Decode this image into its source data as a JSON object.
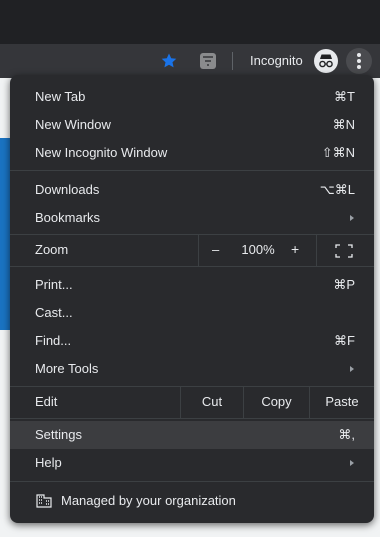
{
  "toolbar": {
    "incognito_label": "Incognito",
    "star_icon": "star-icon",
    "extension_icon": "extension-filter-icon",
    "profile_icon": "incognito-spy-icon",
    "menu_icon": "kebab-menu-icon",
    "accent_color": "#1a73e8"
  },
  "menu": {
    "new_tab": {
      "label": "New Tab",
      "shortcut": "⌘T"
    },
    "new_window": {
      "label": "New Window",
      "shortcut": "⌘N"
    },
    "new_incognito": {
      "label": "New Incognito Window",
      "shortcut": "⇧⌘N"
    },
    "downloads": {
      "label": "Downloads",
      "shortcut": "⌥⌘L"
    },
    "bookmarks": {
      "label": "Bookmarks"
    },
    "zoom": {
      "label": "Zoom",
      "minus": "–",
      "value": "100%",
      "plus": "+"
    },
    "print": {
      "label": "Print...",
      "shortcut": "⌘P"
    },
    "cast": {
      "label": "Cast..."
    },
    "find": {
      "label": "Find...",
      "shortcut": "⌘F"
    },
    "more_tools": {
      "label": "More Tools"
    },
    "edit": {
      "label": "Edit",
      "cut": "Cut",
      "copy": "Copy",
      "paste": "Paste"
    },
    "settings": {
      "label": "Settings",
      "shortcut": "⌘,"
    },
    "help": {
      "label": "Help"
    },
    "managed": {
      "label": "Managed by your organization"
    }
  }
}
